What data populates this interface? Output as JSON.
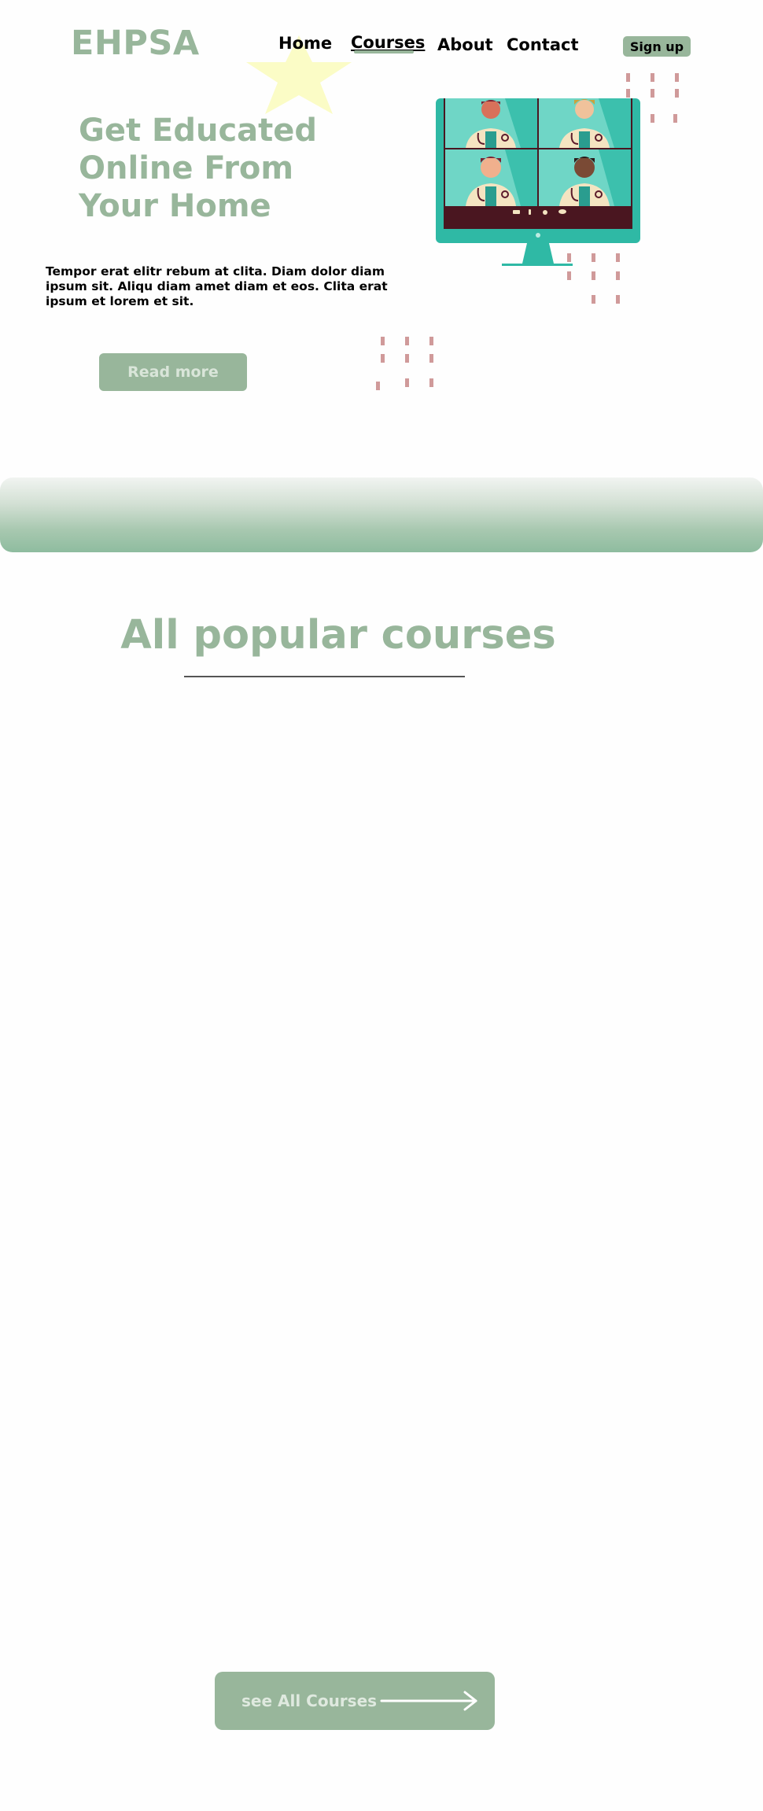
{
  "header": {
    "logo": "EHPSA",
    "nav": {
      "home": "Home",
      "courses": "Courses",
      "about": "About",
      "contact": "Contact"
    },
    "active_nav": "Courses",
    "signup_label": "Sign up"
  },
  "hero": {
    "title_lines": [
      "Get Educated",
      "Online From",
      "Your Home"
    ],
    "description": "Tempor erat elitr rebum at clita. Diam dolor diam ipsum sit. Aliqu diam amet diam et eos. Clita erat ipsum et lorem et sit.",
    "read_more_label": "Read more",
    "illustration": "video-call-doctors-monitor"
  },
  "courses": {
    "title": "All popular courses",
    "see_all_label": "see All Courses"
  },
  "colors": {
    "brand_green": "#98b69b",
    "monitor_teal": "#2fb9a5",
    "dot_pink": "#d09a9a",
    "star_yellow": "#fbfcc6"
  },
  "icons": {
    "star": "star-icon",
    "arrow": "arrow-right-icon",
    "dots": "dots-pattern"
  }
}
